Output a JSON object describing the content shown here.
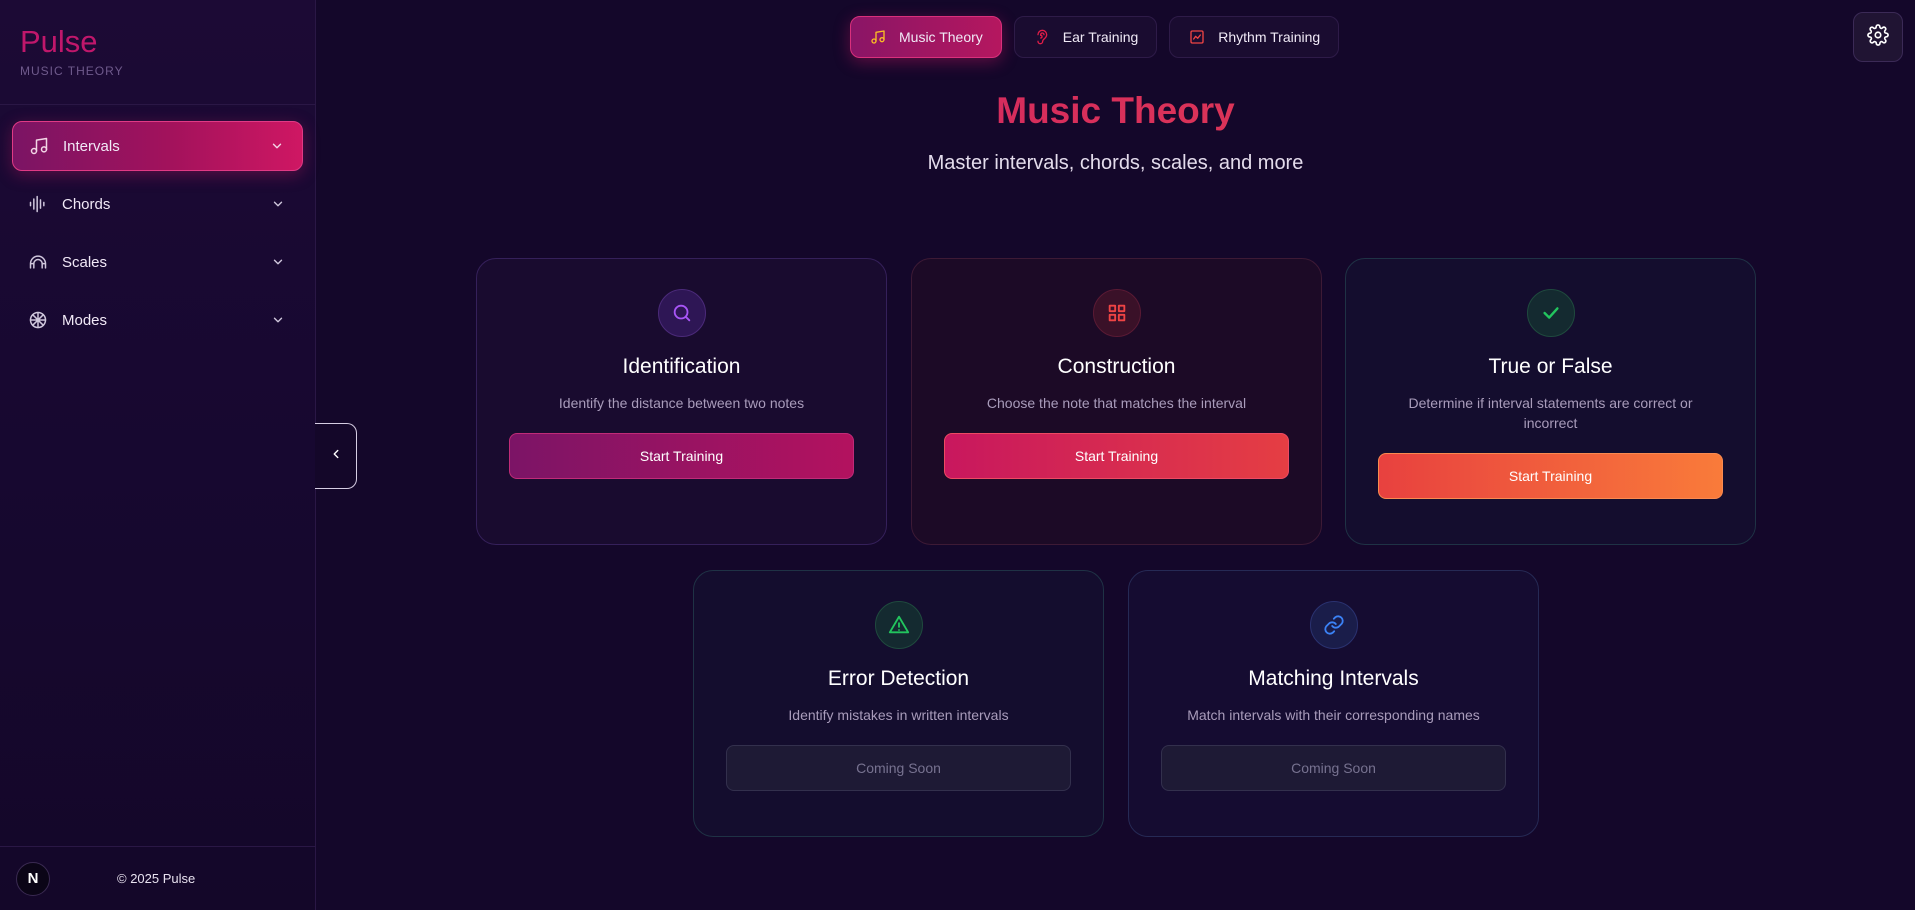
{
  "brand": {
    "title": "Pulse",
    "subtitle": "MUSIC THEORY"
  },
  "sidebar": {
    "items": [
      {
        "label": "Intervals",
        "icon": "music-note-icon",
        "active": true
      },
      {
        "label": "Chords",
        "icon": "waveform-icon",
        "active": false
      },
      {
        "label": "Scales",
        "icon": "arch-icon",
        "active": false
      },
      {
        "label": "Modes",
        "icon": "wheel-icon",
        "active": false
      }
    ],
    "footer": {
      "badge": "N",
      "copyright": "© 2025 Pulse"
    }
  },
  "tabs": [
    {
      "label": "Music Theory",
      "icon": "music-note-icon",
      "active": true
    },
    {
      "label": "Ear Training",
      "icon": "ear-icon",
      "active": false
    },
    {
      "label": "Rhythm Training",
      "icon": "rhythm-icon",
      "active": false
    }
  ],
  "header": {
    "title": "Music Theory",
    "subtitle": "Master intervals, chords, scales, and more"
  },
  "cards": [
    {
      "title": "Identification",
      "desc": "Identify the distance between two notes",
      "button": "Start Training",
      "icon": "search-icon",
      "accent": "#a855f7"
    },
    {
      "title": "Construction",
      "desc": "Choose the note that matches the interval",
      "button": "Start Training",
      "icon": "grid-icon",
      "accent": "#ef4444"
    },
    {
      "title": "True or False",
      "desc": "Determine if interval statements are correct or incorrect",
      "button": "Start Training",
      "icon": "check-icon",
      "accent": "#22c55e"
    },
    {
      "title": "Error Detection",
      "desc": "Identify mistakes in written intervals",
      "button": "Coming Soon",
      "icon": "warning-icon",
      "accent": "#22c55e"
    },
    {
      "title": "Matching Intervals",
      "desc": "Match intervals with their corresponding names",
      "button": "Coming Soon",
      "icon": "link-icon",
      "accent": "#3b82f6"
    }
  ],
  "colors": {
    "background": "#14072a",
    "accent_pink": "#c0176b",
    "accent_orange": "#f97b3a"
  }
}
